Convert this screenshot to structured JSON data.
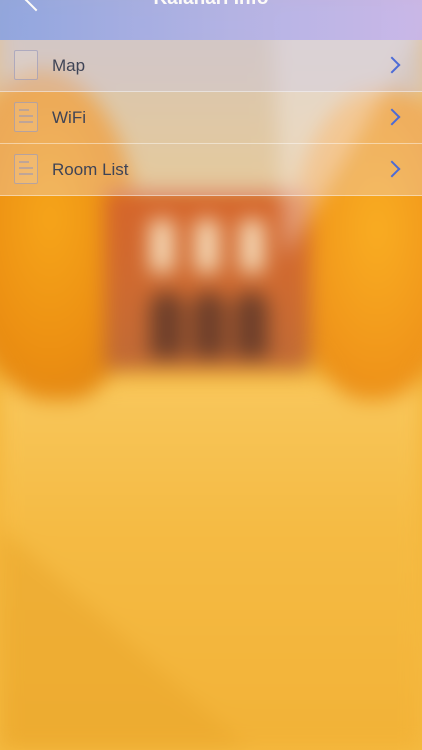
{
  "header": {
    "title": "Kalahari Info",
    "back_icon": "chevron-left-icon"
  },
  "menu": {
    "items": [
      {
        "label": "Map",
        "icon": "map-icon"
      },
      {
        "label": "WiFi",
        "icon": "document-icon"
      },
      {
        "label": "Room List",
        "icon": "document-icon"
      }
    ],
    "chevron_icon": "chevron-right-icon"
  },
  "colors": {
    "header_start": "#8fa6e2",
    "header_end": "#c8b6ea",
    "chevron": "#4d6bd6",
    "label": "#3f4456"
  }
}
